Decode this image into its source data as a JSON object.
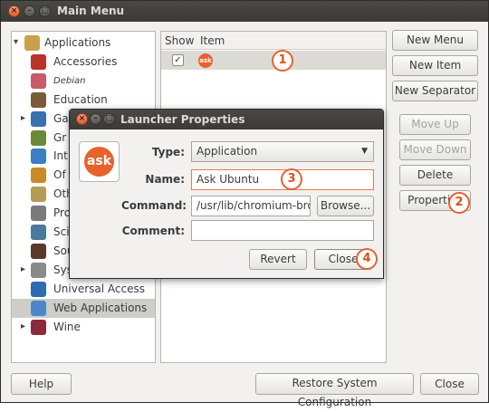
{
  "window": {
    "title": "Main Menu"
  },
  "tree": {
    "items": [
      {
        "label": "Applications",
        "icon": "applications-folder-icon",
        "expander": "▾",
        "level": 0
      },
      {
        "label": "Accessories",
        "icon": "accessories-icon",
        "level": 1
      },
      {
        "label": "Debian",
        "icon": "debian-icon",
        "level": 1,
        "small": true
      },
      {
        "label": "Education",
        "icon": "education-icon",
        "level": 1
      },
      {
        "label": "Ga",
        "icon": "games-icon",
        "expander": "▸",
        "level": 1
      },
      {
        "label": "Gr",
        "icon": "graphics-icon",
        "level": 1
      },
      {
        "label": "Int",
        "icon": "internet-icon",
        "level": 1
      },
      {
        "label": "Of",
        "icon": "office-icon",
        "level": 1
      },
      {
        "label": "Oth",
        "icon": "other-icon",
        "level": 1
      },
      {
        "label": "Pro",
        "icon": "programming-icon",
        "level": 1
      },
      {
        "label": "Sci",
        "icon": "science-icon",
        "level": 1
      },
      {
        "label": "Sou",
        "icon": "sound-video-icon",
        "level": 1
      },
      {
        "label": "Sys",
        "icon": "system-icon",
        "expander": "▸",
        "level": 1
      },
      {
        "label": "Universal Access",
        "icon": "universal-access-icon",
        "level": 1
      },
      {
        "label": "Web Applications",
        "icon": "web-applications-icon",
        "level": 1,
        "selected": true
      },
      {
        "label": "Wine",
        "icon": "wine-icon",
        "expander": "▸",
        "level": 1
      }
    ]
  },
  "list": {
    "headers": {
      "show": "Show",
      "item": "Item"
    },
    "rows": [
      {
        "checked": "✓",
        "icon_text": "ask"
      }
    ]
  },
  "side_buttons": {
    "new_menu": "New Menu",
    "new_item": "New Item",
    "new_separator": "New Separator",
    "move_up": "Move Up",
    "move_down": "Move Down",
    "delete": "Delete",
    "properties": "Properties"
  },
  "bottom_buttons": {
    "help": "Help",
    "restore": "Restore System Configuration",
    "close": "Close"
  },
  "dialog": {
    "title": "Launcher Properties",
    "icon_text": "ask",
    "type_label": "Type:",
    "type_value": "Application",
    "name_label": "Name:",
    "name_value": "Ask Ubuntu",
    "command_label": "Command:",
    "command_value": "/usr/lib/chromium-bro",
    "browse": "Browse...",
    "comment_label": "Comment:",
    "comment_value": "",
    "revert": "Revert",
    "close": "Close"
  },
  "annotations": {
    "1": "1",
    "2": "2",
    "3": "3",
    "4": "4"
  },
  "colors": {
    "accent": "#e8622c",
    "titlebar": "#3c3b37",
    "selection": "#cfcdc8"
  }
}
